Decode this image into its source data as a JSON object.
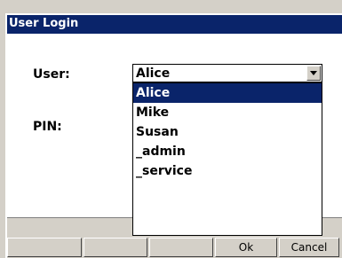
{
  "window": {
    "title": "User Login"
  },
  "form": {
    "user_label": "User:",
    "pin_label": "PIN:",
    "user_selected": "Alice"
  },
  "dropdown": {
    "options": [
      "Alice",
      "Mike",
      "Susan",
      "_admin",
      "_service"
    ],
    "selected_index": 0
  },
  "buttons": {
    "blank1": "",
    "blank2": "",
    "blank3": "",
    "ok": "Ok",
    "cancel": "Cancel"
  },
  "colors": {
    "titlebar": "#0a246a",
    "selection": "#0a246a",
    "face": "#d4d0c8"
  }
}
